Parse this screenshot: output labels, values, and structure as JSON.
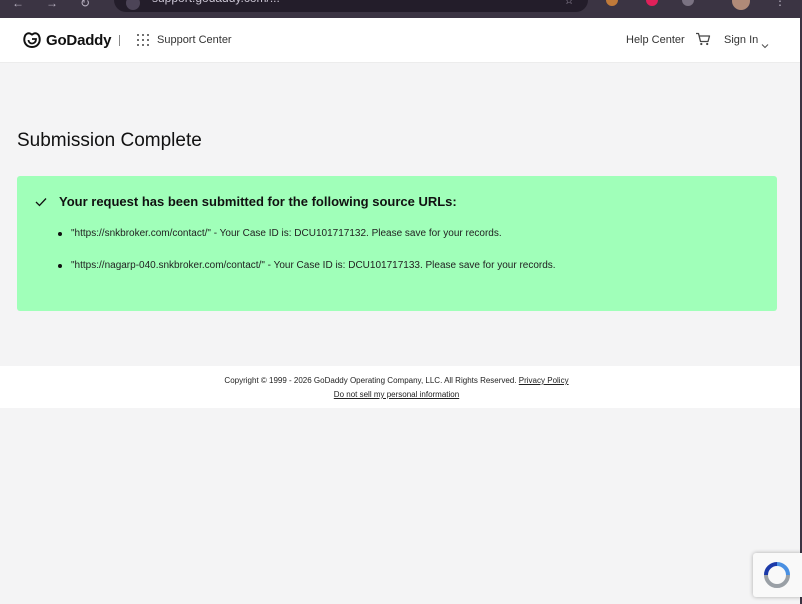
{
  "browser": {
    "url_fragment": "support.godaddy.com/... "
  },
  "header": {
    "logo_text": "GoDaddy",
    "support_center": "Support Center",
    "help_center": "Help Center",
    "sign_in": "Sign In"
  },
  "main": {
    "title": "Submission Complete",
    "panel": {
      "heading": "Your request has been submitted for the following source URLs:",
      "items": [
        "\"https://snkbroker.com/contact/\" - Your Case ID is: DCU101717132. Please save for your records.",
        "\"https://nagarp-040.snkbroker.com/contact/\" - Your Case ID is: DCU101717133. Please save for your records."
      ],
      "color": "#a0ffb9"
    }
  },
  "footer": {
    "copyright": "Copyright © 1999 - 2026 GoDaddy Operating Company, LLC. All Rights Reserved.",
    "privacy_link": "Privacy Policy",
    "do_not_sell": "Do not sell my personal information"
  },
  "icons": {
    "logo": "godaddy-logo-icon",
    "apps": "apps-grid-icon",
    "cart": "shopping-cart-icon",
    "chevron": "chevron-down-icon",
    "check": "checkmark-icon",
    "recaptcha": "recaptcha-icon"
  }
}
